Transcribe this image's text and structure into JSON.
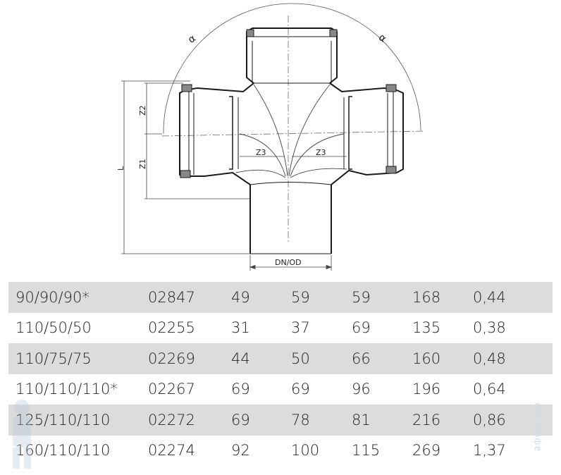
{
  "drawing": {
    "angle_symbol": "α",
    "dim_z2": "Z2",
    "dim_z1": "Z1",
    "dim_l": "L",
    "dim_z3": "Z3",
    "dim_dn": "DN/OD"
  },
  "table": {
    "rows": [
      [
        "90/90/90*",
        "02847",
        "49",
        "59",
        "59",
        "168",
        "0,44"
      ],
      [
        "110/50/50",
        "02255",
        "31",
        "37",
        "69",
        "135",
        "0,38"
      ],
      [
        "110/75/75",
        "02269",
        "44",
        "50",
        "66",
        "160",
        "0,48"
      ],
      [
        "110/110/110*",
        "02267",
        "69",
        "69",
        "96",
        "196",
        "0,64"
      ],
      [
        "125/110/110",
        "02272",
        "69",
        "78",
        "81",
        "216",
        "0,86"
      ],
      [
        "160/110/110",
        "02274",
        "92",
        "100",
        "115",
        "269",
        "1,37"
      ]
    ]
  },
  "watermark": "афоня.рф",
  "colors": {
    "row_shade": "#dcdcdc",
    "line": "#1a1a1a",
    "seal": "#888888"
  }
}
